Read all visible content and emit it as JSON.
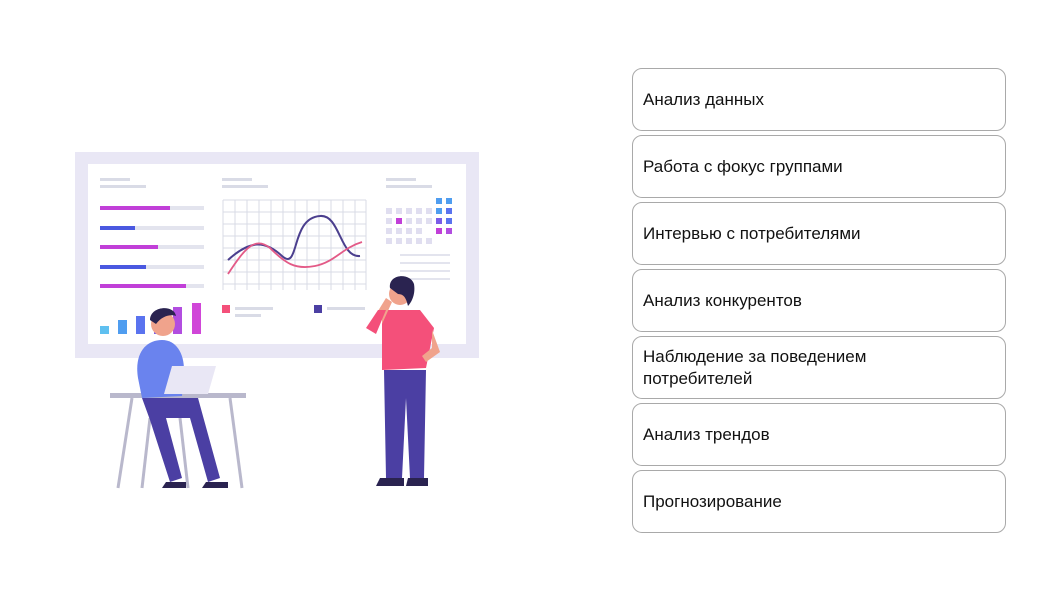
{
  "items": [
    {
      "label": "Анализ данных"
    },
    {
      "label": "Работа с фокус группами"
    },
    {
      "label": "Интервью с потребителями"
    },
    {
      "label": "Анализ конкурентов"
    },
    {
      "label": "Наблюдение за поведением потребителей"
    },
    {
      "label": "Анализ трендов"
    },
    {
      "label": "Прогнозирование"
    }
  ],
  "colors": {
    "board_frame": "#e9e7f5",
    "accent_purple": "#c13fd8",
    "accent_blue": "#4a58e0",
    "person_shirt_red": "#f4507a",
    "person_pants_indigo": "#4b3fa3",
    "person_shirt_blue": "#6a83ee"
  }
}
